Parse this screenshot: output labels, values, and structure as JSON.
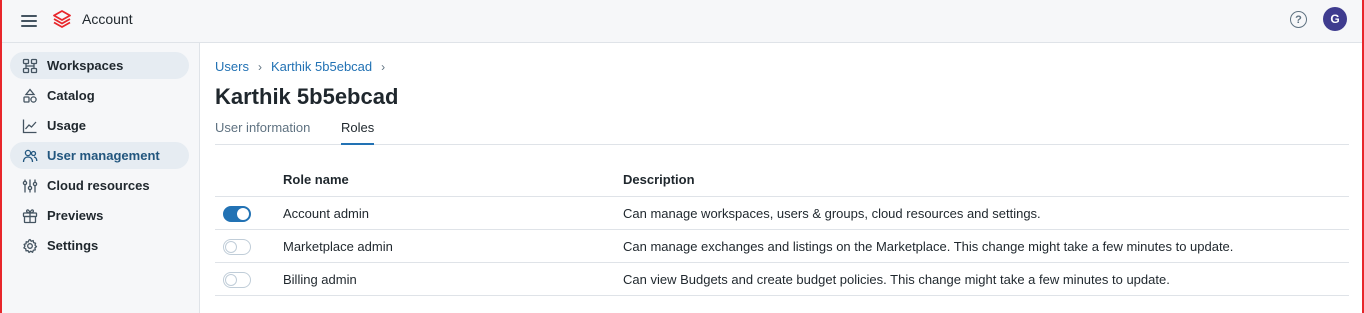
{
  "header": {
    "app_title": "Account",
    "avatar_initial": "G",
    "help_symbol": "?"
  },
  "sidebar": {
    "items": [
      {
        "label": "Workspaces",
        "icon": "workspaces-icon",
        "selected": true
      },
      {
        "label": "Catalog",
        "icon": "catalog-icon"
      },
      {
        "label": "Usage",
        "icon": "usage-icon"
      },
      {
        "label": "User management",
        "icon": "user-management-icon",
        "selected": true,
        "active": true
      },
      {
        "label": "Cloud resources",
        "icon": "cloud-resources-icon"
      },
      {
        "label": "Previews",
        "icon": "previews-icon"
      },
      {
        "label": "Settings",
        "icon": "settings-icon"
      }
    ]
  },
  "breadcrumb": {
    "items": [
      "Users",
      "Karthik 5b5ebcad"
    ],
    "separator": "›"
  },
  "page": {
    "title": "Karthik 5b5ebcad"
  },
  "tabs": [
    {
      "label": "User information",
      "active": false
    },
    {
      "label": "Roles",
      "active": true
    }
  ],
  "roles_table": {
    "columns": [
      "Role name",
      "Description"
    ],
    "rows": [
      {
        "name": "Account admin",
        "enabled": true,
        "description": "Can manage workspaces, users & groups, cloud resources and settings."
      },
      {
        "name": "Marketplace admin",
        "enabled": false,
        "description": "Can manage exchanges and listings on the Marketplace. This change might take a few minutes to update."
      },
      {
        "name": "Billing admin",
        "enabled": false,
        "description": "Can view Budgets and create budget policies. This change might take a few minutes to update."
      }
    ]
  },
  "colors": {
    "accent": "#2272b4",
    "active_nav_text": "#22567e",
    "avatar_bg": "#3f3c8f",
    "logo": "#e8262b"
  }
}
